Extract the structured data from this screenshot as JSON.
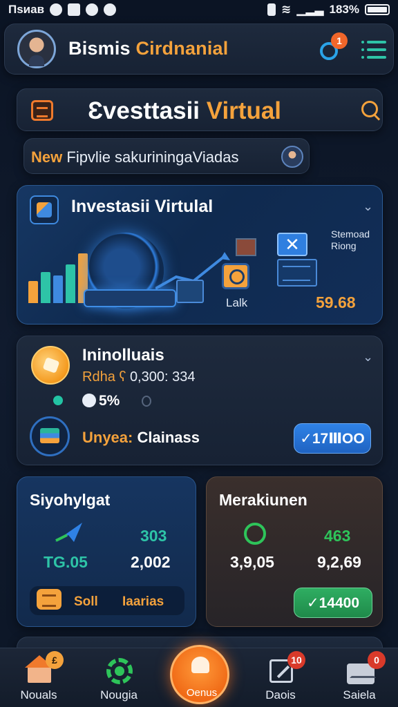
{
  "status_bar": {
    "time": "Пѕиав",
    "battery": "183%"
  },
  "header": {
    "title_main": "Bismis ",
    "title_accent": "Cirdnanial",
    "notification_count": "1"
  },
  "search": {
    "title_main": "Ɛvesttasii ",
    "title_accent": "Virtual"
  },
  "ticker": {
    "tag": "New",
    "text": "Fipvlie sakuriningaViadas"
  },
  "hero": {
    "title": "Investasii Virtulal",
    "side_label_1": "Stemoad",
    "side_label_2": "Riong",
    "icon_label": "Lalk",
    "value": "59.68",
    "bars": [
      {
        "value": 0.45,
        "color": "#f4a23c"
      },
      {
        "value": 0.62,
        "color": "#2ec4a7"
      },
      {
        "value": 0.55,
        "color": "#3f8ae0"
      },
      {
        "value": 0.78,
        "color": "#2ec4a7"
      },
      {
        "value": 1.0,
        "color": "#f4a23c"
      }
    ]
  },
  "stock": {
    "title": "Ininolluais",
    "sub_accent": "Rdha ʕ ",
    "sub_value": "0,300: 334",
    "percent": "5%",
    "row_accent": "Unyea: ",
    "row_label": "Clainass",
    "buy_label": "✓17ⅢOO"
  },
  "tile_left": {
    "title": "Siyohylgat",
    "val_top": "303",
    "val_left": "TG.05",
    "val_right": "2,002",
    "chip_a": "Soll",
    "chip_b": "Iaarias"
  },
  "tile_right": {
    "title": "Merakiunen",
    "val_top": "463",
    "val_left": "3,9,05",
    "val_right": "9,2,69",
    "btn_label": "✓14400"
  },
  "tabs": [
    {
      "label": "Nouals",
      "badge": "£"
    },
    {
      "label": "Nougia"
    },
    {
      "label": "Oenus"
    },
    {
      "label": "Daois",
      "badge": "10"
    },
    {
      "label": "Saiela",
      "badge": "0"
    }
  ],
  "colors": {
    "accent_orange": "#f4a23c",
    "accent_blue": "#2f82e6",
    "accent_green": "#2ec45a",
    "background": "#0b1424"
  }
}
